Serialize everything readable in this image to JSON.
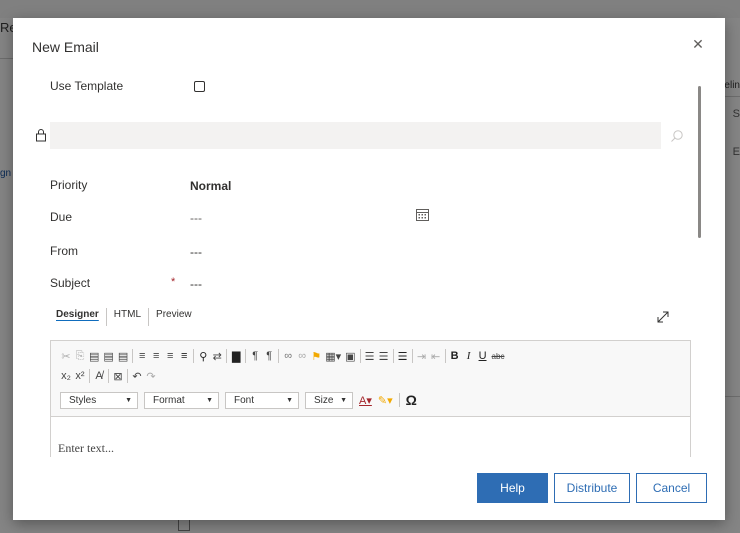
{
  "background": {
    "left_text": "Re",
    "left_link": "gn",
    "right_text_1": "elin",
    "right_text_2": "S",
    "right_text_3": "E"
  },
  "dialog": {
    "title": "New Email",
    "use_template_label": "Use Template",
    "lookup_value": "",
    "priority_label": "Priority",
    "priority_value": "Normal",
    "due_label": "Due",
    "due_value": "---",
    "from_label": "From",
    "from_value": "---",
    "subject_label": "Subject",
    "subject_required": "*",
    "subject_value": "---"
  },
  "editor": {
    "tabs": [
      "Designer",
      "HTML",
      "Preview"
    ],
    "active_tab": "Designer",
    "combos": {
      "styles": "Styles",
      "format": "Format",
      "font": "Font",
      "size": "Size"
    },
    "placeholder": "Enter text..."
  },
  "footer": {
    "help_label": "Help",
    "distribute_label": "Distribute",
    "cancel_label": "Cancel"
  },
  "colors": {
    "primary": "#2e6db4",
    "required": "#a4262c",
    "overlay": "#808080"
  }
}
